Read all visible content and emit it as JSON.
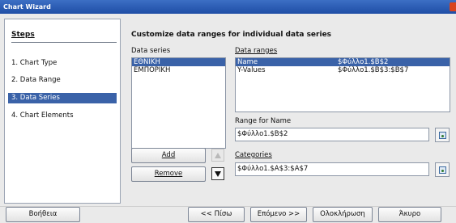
{
  "window": {
    "title": "Chart Wizard"
  },
  "steps": {
    "heading": "Steps",
    "items": [
      {
        "label": "1. Chart Type"
      },
      {
        "label": "2. Data Range"
      },
      {
        "label": "3. Data Series"
      },
      {
        "label": "4. Chart Elements"
      }
    ],
    "active_index": 2
  },
  "main": {
    "title": "Customize data ranges for individual data series",
    "data_series": {
      "label": "Data series",
      "items": [
        "ΕΘΝΙΚΗ",
        "ΕΜΠΟΡΙΚΗ"
      ],
      "selected_index": 0
    },
    "data_ranges": {
      "label": "Data ranges",
      "rows": [
        {
          "name": "Name",
          "range": "$Φύλλο1.$B$2"
        },
        {
          "name": "Y-Values",
          "range": "$Φύλλο1.$B$3:$B$7"
        }
      ],
      "selected_index": 0
    },
    "range_for_name": {
      "label": "Range for Name",
      "value": "$Φύλλο1.$B$2"
    },
    "categories": {
      "label": "Categories",
      "value": "$Φύλλο1.$A$3:$A$7"
    },
    "add_label": "Add",
    "remove_label": "Remove"
  },
  "footer": {
    "help": "Βοήθεια",
    "back": "<< Πίσω",
    "next": "Επόμενο >>",
    "finish": "Ολοκλήρωση",
    "cancel": "Άκυρο"
  },
  "colors": {
    "selection": "#3a62a8",
    "titlebar": "#2a5bb5",
    "close": "#d9431d"
  }
}
